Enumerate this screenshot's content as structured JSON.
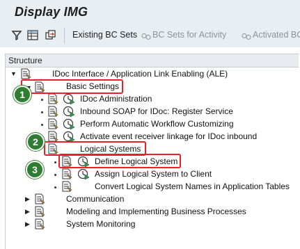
{
  "window": {
    "title": "Display IMG"
  },
  "toolbar": {
    "existing_bc_sets": "Existing BC Sets",
    "bc_sets_for_activity": "BC Sets for Activity",
    "activated_bc": "Activated BC"
  },
  "tree": {
    "header": "Structure",
    "root": {
      "label": "IDoc Interface / Application Link Enabling (ALE)",
      "expanded": true
    },
    "basic_settings": {
      "label": "Basic Settings",
      "expanded": true
    },
    "idoc_administration": "IDoc Administration",
    "inbound_soap": "Inbound SOAP for IDoc: Register Service",
    "perform_workflow": "Perform Automatic Workflow Customizing",
    "activate_event": "Activate event receiver linkage for IDoc inbound",
    "logical_systems": {
      "label": "Logical Systems",
      "expanded": true
    },
    "define_logical_system": "Define Logical System",
    "assign_logical_system": "Assign Logical System to Client",
    "convert_logical_system": "Convert Logical System Names in Application Tables",
    "communication": "Communication",
    "modeling": "Modeling and Implementing Business Processes",
    "system_monitoring": "System Monitoring"
  },
  "annotations": [
    {
      "number": "1",
      "color": "#2f7d32"
    },
    {
      "number": "2",
      "color": "#2f7d32"
    },
    {
      "number": "3",
      "color": "#2f7d32"
    }
  ],
  "colors": {
    "highlight": "#e8202a",
    "badge": "#2f7d32",
    "toolbar_bg": "#e9eef3"
  }
}
